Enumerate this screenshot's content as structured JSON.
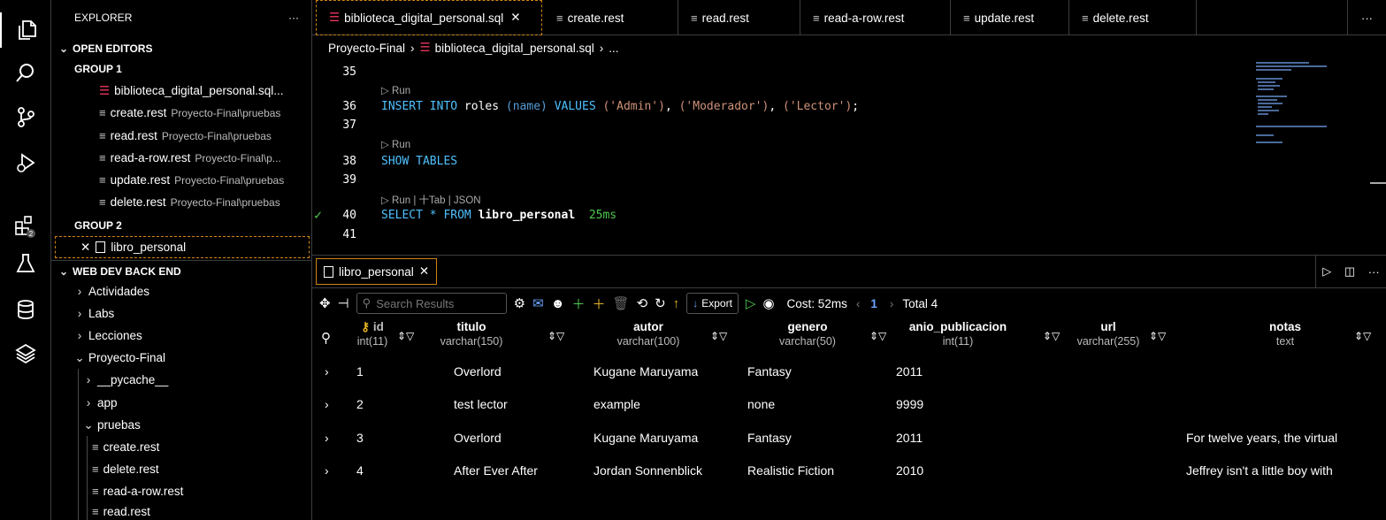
{
  "sidebar": {
    "title": "EXPLORER",
    "more": "···",
    "sections": {
      "open_editors": "OPEN EDITORS",
      "group1": "GROUP 1",
      "group2": "GROUP 2",
      "project": "WEB DEV BACK END"
    },
    "open_editors": [
      {
        "name": "biblioteca_digital_personal.sql...",
        "desc": ""
      },
      {
        "name": "create.rest",
        "desc": "Proyecto-Final\\pruebas"
      },
      {
        "name": "read.rest",
        "desc": "Proyecto-Final\\pruebas"
      },
      {
        "name": "read-a-row.rest",
        "desc": "Proyecto-Final\\p..."
      },
      {
        "name": "update.rest",
        "desc": "Proyecto-Final\\pruebas"
      },
      {
        "name": "delete.rest",
        "desc": "Proyecto-Final\\pruebas"
      }
    ],
    "group2_item": "libro_personal",
    "tree": {
      "actividades": "Actividades",
      "labs": "Labs",
      "lecciones": "Lecciones",
      "proyecto": "Proyecto-Final",
      "pycache": "__pycache__",
      "app": "app",
      "pruebas": "pruebas",
      "files": [
        "create.rest",
        "delete.rest",
        "read-a-row.rest",
        "read.rest"
      ]
    }
  },
  "tabs": [
    "biblioteca_digital_personal.sql",
    "create.rest",
    "read.rest",
    "read-a-row.rest",
    "update.rest",
    "delete.rest"
  ],
  "tabs_more": "···",
  "breadcrumb": {
    "folder": "Proyecto-Final",
    "file": "biblioteca_digital_personal.sql",
    "rest": "..."
  },
  "editor": {
    "lines": {
      "l35": "35",
      "l36": "36",
      "l37": "37",
      "l38": "38",
      "l39": "39",
      "l40": "40",
      "l41": "41"
    },
    "lens_run": "▷ Run",
    "lens_full": "▷ Run | ⼗Tab | JSON",
    "c36": {
      "kw1": "INSERT INTO",
      "t": "roles",
      "n": "(name)",
      "kw2": "VALUES",
      "a": "('Admin')",
      "b": "('Moderador')",
      "c": "('Lector')"
    },
    "c38": "SHOW TABLES",
    "c40": {
      "kw": "SELECT * FROM",
      "t": "libro_personal",
      "time": "25ms"
    }
  },
  "panel": {
    "tab": "libro_personal",
    "search_placeholder": "Search Results",
    "export": "Export",
    "cost": "Cost: 52ms",
    "page": "1",
    "total": "Total 4",
    "columns": [
      {
        "name": "id",
        "type": "int(11)"
      },
      {
        "name": "titulo",
        "type": "varchar(150)"
      },
      {
        "name": "autor",
        "type": "varchar(100)"
      },
      {
        "name": "genero",
        "type": "varchar(50)"
      },
      {
        "name": "anio_publicacion",
        "type": "int(11)"
      },
      {
        "name": "url",
        "type": "varchar(255)"
      },
      {
        "name": "notas",
        "type": "text"
      }
    ],
    "rows": [
      [
        "1",
        "Overlord",
        "Kugane Maruyama",
        "Fantasy",
        "2011",
        "",
        ""
      ],
      [
        "2",
        "test lector",
        "example",
        "none",
        "9999",
        "",
        ""
      ],
      [
        "3",
        "Overlord",
        "Kugane Maruyama",
        "Fantasy",
        "2011",
        "",
        "For twelve years, the virtual"
      ],
      [
        "4",
        "After Ever After",
        "Jordan Sonnenblick",
        "Realistic Fiction",
        "2010",
        "",
        "Jeffrey isn't a little boy with"
      ]
    ]
  },
  "colors": {
    "accent": "#d18616",
    "db_icon": "#e8365b",
    "keyword": "#4fc1ff",
    "string": "#ce9178",
    "success": "#4ec94e"
  },
  "icons": [
    "files-icon",
    "search-icon",
    "source-control-icon",
    "run-debug-icon",
    "extensions-icon",
    "testing-icon",
    "database-icon",
    "layers-icon"
  ]
}
